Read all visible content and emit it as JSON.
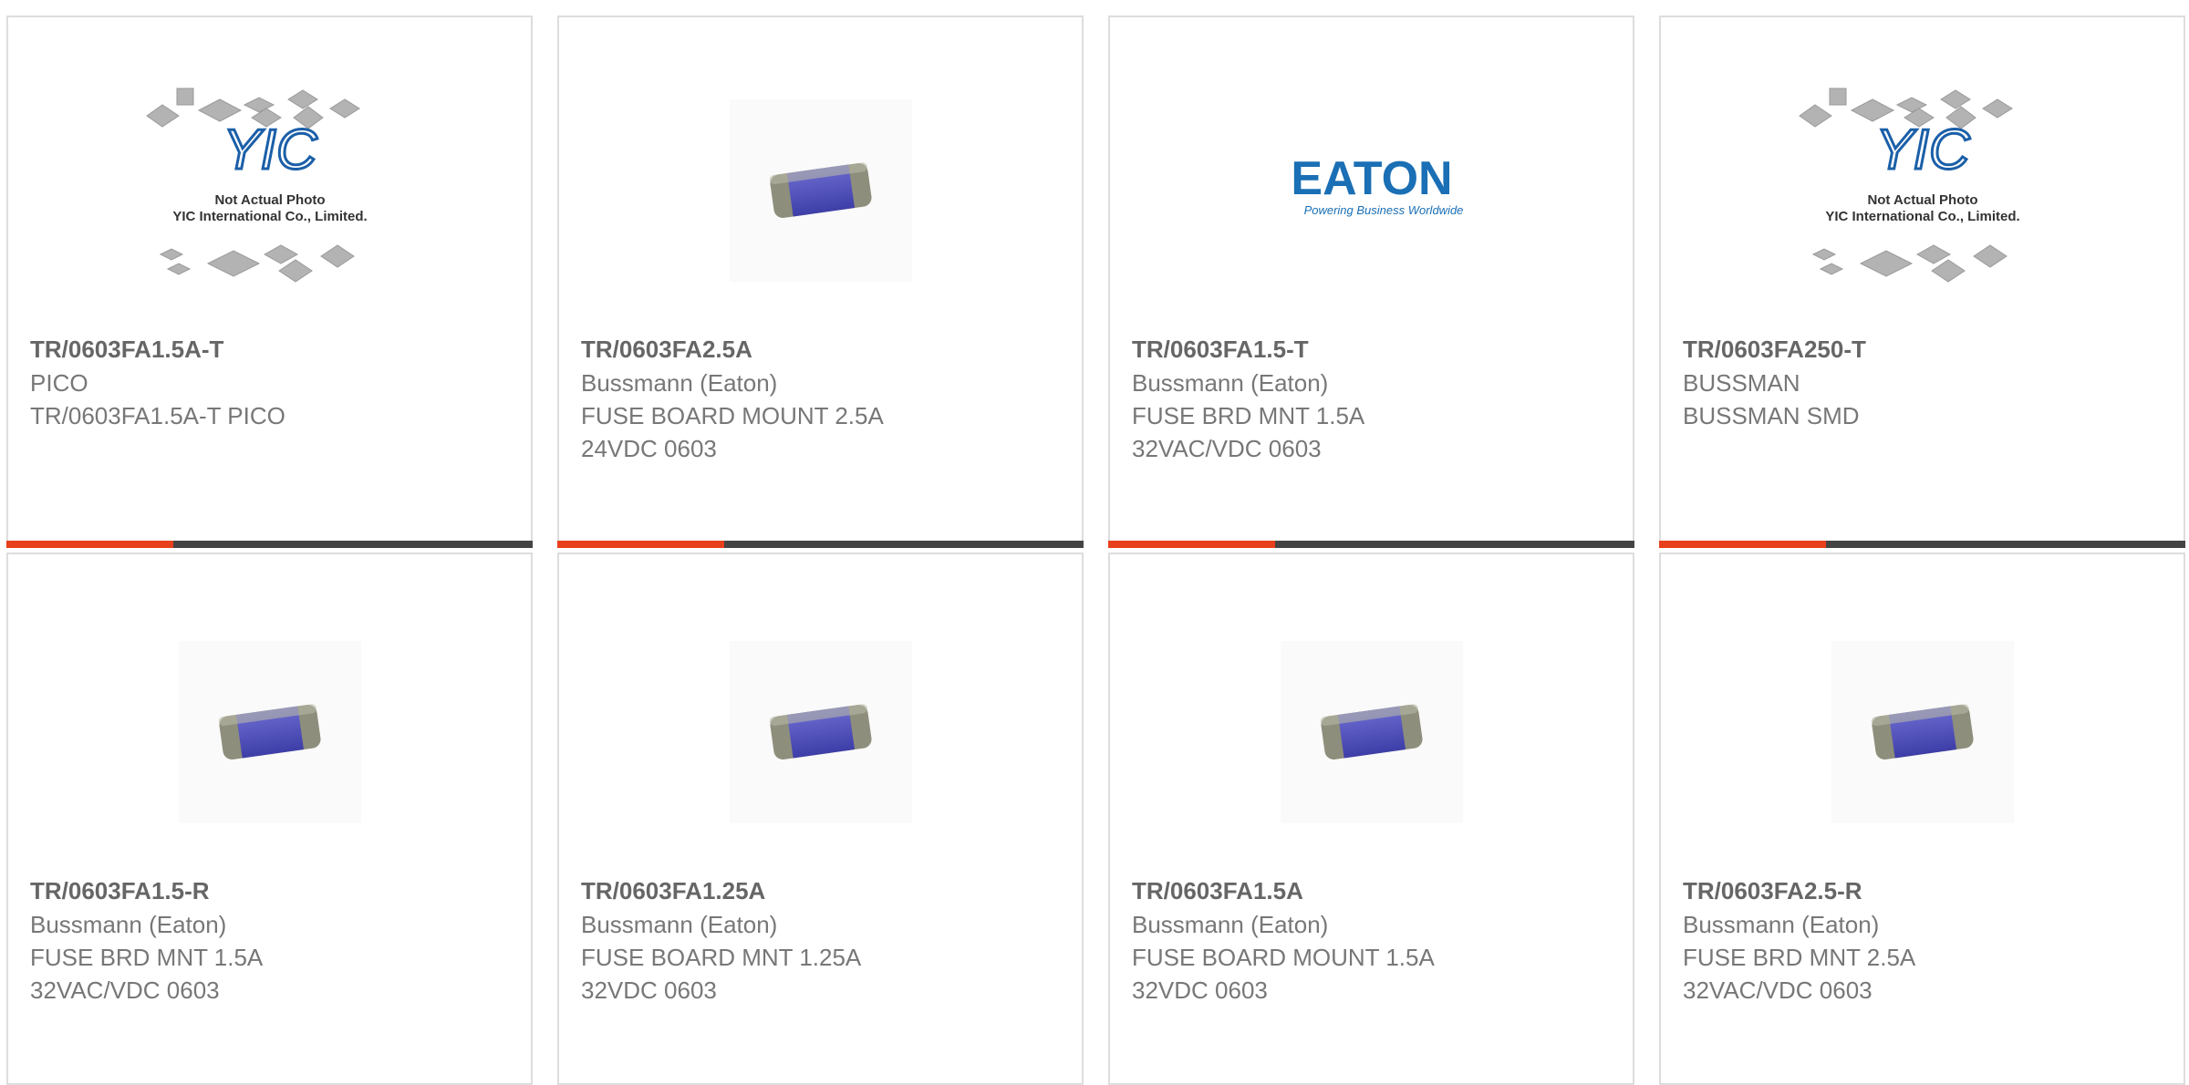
{
  "colors": {
    "accent": "#e8401c",
    "bar": "#444444",
    "border": "#dddddd"
  },
  "yic_caption": [
    "Not Actual Photo",
    "YIC International Co., Limited."
  ],
  "eaton": {
    "name": "EATON",
    "tagline": "Powering Business Worldwide"
  },
  "products": [
    {
      "part_number": "TR/0603FA1.5A-T",
      "manufacturer": "PICO",
      "description": "TR/0603FA1.5A-T PICO",
      "image": "yic-placeholder"
    },
    {
      "part_number": "TR/0603FA2.5A",
      "manufacturer": "Bussmann (Eaton)",
      "description": "FUSE BOARD MOUNT 2.5A\n24VDC 0603",
      "image": "smd-fuse"
    },
    {
      "part_number": "TR/0603FA1.5-T",
      "manufacturer": "Bussmann (Eaton)",
      "description": "FUSE BRD MNT 1.5A\n32VAC/VDC 0603",
      "image": "eaton-logo"
    },
    {
      "part_number": "TR/0603FA250-T",
      "manufacturer": "BUSSMAN",
      "description": "BUSSMAN SMD",
      "image": "yic-placeholder"
    },
    {
      "part_number": "TR/0603FA1.5-R",
      "manufacturer": "Bussmann (Eaton)",
      "description": "FUSE BRD MNT 1.5A\n32VAC/VDC 0603",
      "image": "smd-fuse"
    },
    {
      "part_number": "TR/0603FA1.25A",
      "manufacturer": "Bussmann (Eaton)",
      "description": "FUSE BOARD MNT 1.25A\n32VDC 0603",
      "image": "smd-fuse"
    },
    {
      "part_number": "TR/0603FA1.5A",
      "manufacturer": "Bussmann (Eaton)",
      "description": "FUSE BOARD MOUNT 1.5A\n32VDC 0603",
      "image": "smd-fuse"
    },
    {
      "part_number": "TR/0603FA2.5-R",
      "manufacturer": "Bussmann (Eaton)",
      "description": "FUSE BRD MNT 2.5A\n32VAC/VDC 0603",
      "image": "smd-fuse"
    }
  ]
}
